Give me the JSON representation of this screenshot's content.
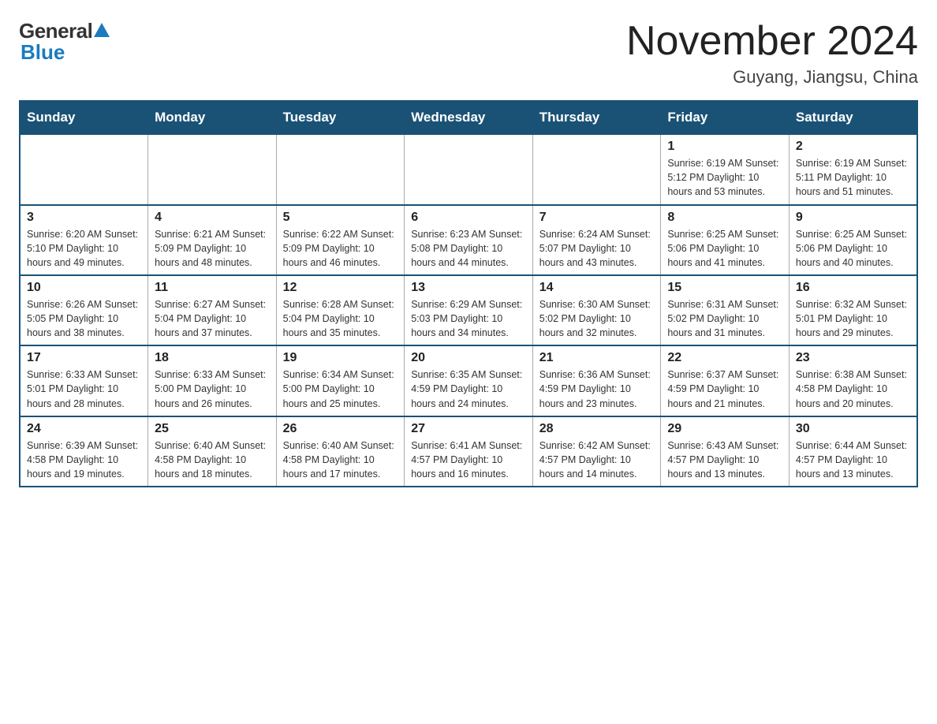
{
  "header": {
    "logo_general": "General",
    "logo_blue": "Blue",
    "month_title": "November 2024",
    "location": "Guyang, Jiangsu, China"
  },
  "weekdays": [
    "Sunday",
    "Monday",
    "Tuesday",
    "Wednesday",
    "Thursday",
    "Friday",
    "Saturday"
  ],
  "weeks": [
    [
      {
        "day": "",
        "info": ""
      },
      {
        "day": "",
        "info": ""
      },
      {
        "day": "",
        "info": ""
      },
      {
        "day": "",
        "info": ""
      },
      {
        "day": "",
        "info": ""
      },
      {
        "day": "1",
        "info": "Sunrise: 6:19 AM\nSunset: 5:12 PM\nDaylight: 10 hours and 53 minutes."
      },
      {
        "day": "2",
        "info": "Sunrise: 6:19 AM\nSunset: 5:11 PM\nDaylight: 10 hours and 51 minutes."
      }
    ],
    [
      {
        "day": "3",
        "info": "Sunrise: 6:20 AM\nSunset: 5:10 PM\nDaylight: 10 hours and 49 minutes."
      },
      {
        "day": "4",
        "info": "Sunrise: 6:21 AM\nSunset: 5:09 PM\nDaylight: 10 hours and 48 minutes."
      },
      {
        "day": "5",
        "info": "Sunrise: 6:22 AM\nSunset: 5:09 PM\nDaylight: 10 hours and 46 minutes."
      },
      {
        "day": "6",
        "info": "Sunrise: 6:23 AM\nSunset: 5:08 PM\nDaylight: 10 hours and 44 minutes."
      },
      {
        "day": "7",
        "info": "Sunrise: 6:24 AM\nSunset: 5:07 PM\nDaylight: 10 hours and 43 minutes."
      },
      {
        "day": "8",
        "info": "Sunrise: 6:25 AM\nSunset: 5:06 PM\nDaylight: 10 hours and 41 minutes."
      },
      {
        "day": "9",
        "info": "Sunrise: 6:25 AM\nSunset: 5:06 PM\nDaylight: 10 hours and 40 minutes."
      }
    ],
    [
      {
        "day": "10",
        "info": "Sunrise: 6:26 AM\nSunset: 5:05 PM\nDaylight: 10 hours and 38 minutes."
      },
      {
        "day": "11",
        "info": "Sunrise: 6:27 AM\nSunset: 5:04 PM\nDaylight: 10 hours and 37 minutes."
      },
      {
        "day": "12",
        "info": "Sunrise: 6:28 AM\nSunset: 5:04 PM\nDaylight: 10 hours and 35 minutes."
      },
      {
        "day": "13",
        "info": "Sunrise: 6:29 AM\nSunset: 5:03 PM\nDaylight: 10 hours and 34 minutes."
      },
      {
        "day": "14",
        "info": "Sunrise: 6:30 AM\nSunset: 5:02 PM\nDaylight: 10 hours and 32 minutes."
      },
      {
        "day": "15",
        "info": "Sunrise: 6:31 AM\nSunset: 5:02 PM\nDaylight: 10 hours and 31 minutes."
      },
      {
        "day": "16",
        "info": "Sunrise: 6:32 AM\nSunset: 5:01 PM\nDaylight: 10 hours and 29 minutes."
      }
    ],
    [
      {
        "day": "17",
        "info": "Sunrise: 6:33 AM\nSunset: 5:01 PM\nDaylight: 10 hours and 28 minutes."
      },
      {
        "day": "18",
        "info": "Sunrise: 6:33 AM\nSunset: 5:00 PM\nDaylight: 10 hours and 26 minutes."
      },
      {
        "day": "19",
        "info": "Sunrise: 6:34 AM\nSunset: 5:00 PM\nDaylight: 10 hours and 25 minutes."
      },
      {
        "day": "20",
        "info": "Sunrise: 6:35 AM\nSunset: 4:59 PM\nDaylight: 10 hours and 24 minutes."
      },
      {
        "day": "21",
        "info": "Sunrise: 6:36 AM\nSunset: 4:59 PM\nDaylight: 10 hours and 23 minutes."
      },
      {
        "day": "22",
        "info": "Sunrise: 6:37 AM\nSunset: 4:59 PM\nDaylight: 10 hours and 21 minutes."
      },
      {
        "day": "23",
        "info": "Sunrise: 6:38 AM\nSunset: 4:58 PM\nDaylight: 10 hours and 20 minutes."
      }
    ],
    [
      {
        "day": "24",
        "info": "Sunrise: 6:39 AM\nSunset: 4:58 PM\nDaylight: 10 hours and 19 minutes."
      },
      {
        "day": "25",
        "info": "Sunrise: 6:40 AM\nSunset: 4:58 PM\nDaylight: 10 hours and 18 minutes."
      },
      {
        "day": "26",
        "info": "Sunrise: 6:40 AM\nSunset: 4:58 PM\nDaylight: 10 hours and 17 minutes."
      },
      {
        "day": "27",
        "info": "Sunrise: 6:41 AM\nSunset: 4:57 PM\nDaylight: 10 hours and 16 minutes."
      },
      {
        "day": "28",
        "info": "Sunrise: 6:42 AM\nSunset: 4:57 PM\nDaylight: 10 hours and 14 minutes."
      },
      {
        "day": "29",
        "info": "Sunrise: 6:43 AM\nSunset: 4:57 PM\nDaylight: 10 hours and 13 minutes."
      },
      {
        "day": "30",
        "info": "Sunrise: 6:44 AM\nSunset: 4:57 PM\nDaylight: 10 hours and 13 minutes."
      }
    ]
  ]
}
